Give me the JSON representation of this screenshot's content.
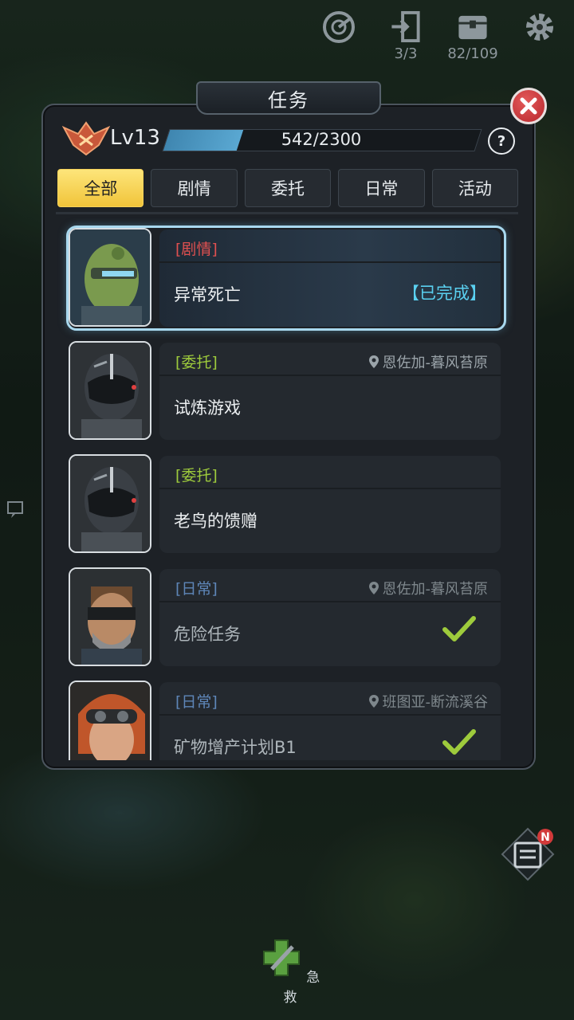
{
  "top_icons": [
    {
      "name": "radar-icon",
      "count": ""
    },
    {
      "name": "exit-icon",
      "count": "3/3"
    },
    {
      "name": "chest-icon",
      "count": "82/109"
    },
    {
      "name": "gear-icon",
      "count": ""
    }
  ],
  "panel": {
    "title": "任务"
  },
  "player": {
    "level": "Lv13",
    "xp_text": "542/2300",
    "xp_fraction": 0.2357
  },
  "tabs": [
    {
      "label": "全部",
      "active": true
    },
    {
      "label": "剧情",
      "active": false
    },
    {
      "label": "委托",
      "active": false
    },
    {
      "label": "日常",
      "active": false
    },
    {
      "label": "活动",
      "active": false
    }
  ],
  "quests": [
    {
      "type": "[剧情]",
      "name": "异常死亡",
      "location": "",
      "status": "【已完成】",
      "check": false
    },
    {
      "type": "[委托]",
      "name": "试炼游戏",
      "location": "恩佐加-暮风苔原",
      "status": "",
      "check": false
    },
    {
      "type": "[委托]",
      "name": "老鸟的馈赠",
      "location": "",
      "status": "",
      "check": false
    },
    {
      "type": "[日常]",
      "name": "危险任务",
      "location": "恩佐加-暮风苔原",
      "status": "",
      "check": true
    },
    {
      "type": "[日常]",
      "name": "矿物增产计划B1",
      "location": "班图亚-断流溪谷",
      "status": "",
      "check": true
    }
  ],
  "bottom": {
    "rescue_label": "急救",
    "task_badge": "N"
  },
  "colors": {
    "accent_yellow": "#f1c43a",
    "story_red": "#e05050",
    "commission_green": "#9ecb3c",
    "daily_blue": "#5e86b8",
    "complete_cyan": "#5ad0f0",
    "check_green": "#9ecb3c"
  }
}
